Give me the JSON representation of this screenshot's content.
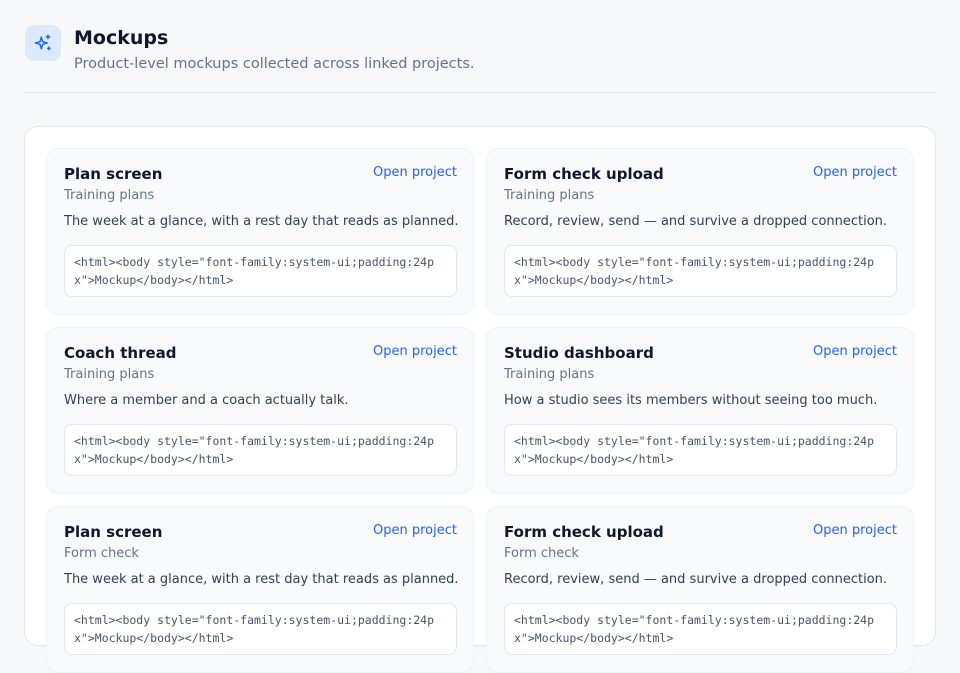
{
  "header": {
    "title": "Mockups",
    "subtitle": "Product-level mockups collected across linked projects.",
    "icon": "sparkles-icon",
    "accent": "#2563eb"
  },
  "cards": [
    {
      "title": "Plan screen",
      "link": "Open project",
      "project": "Training plans",
      "description": "The week at a glance, with a rest day that reads as planned.",
      "code": "<html><body style=\"font-family:system-ui;padding:24px\">Mockup</body></html>"
    },
    {
      "title": "Form check upload",
      "link": "Open project",
      "project": "Training plans",
      "description": "Record, review, send — and survive a dropped connection.",
      "code": "<html><body style=\"font-family:system-ui;padding:24px\">Mockup</body></html>"
    },
    {
      "title": "Coach thread",
      "link": "Open project",
      "project": "Training plans",
      "description": "Where a member and a coach actually talk.",
      "code": "<html><body style=\"font-family:system-ui;padding:24px\">Mockup</body></html>"
    },
    {
      "title": "Studio dashboard",
      "link": "Open project",
      "project": "Training plans",
      "description": "How a studio sees its members without seeing too much.",
      "code": "<html><body style=\"font-family:system-ui;padding:24px\">Mockup</body></html>"
    },
    {
      "title": "Plan screen",
      "link": "Open project",
      "project": "Form check",
      "description": "The week at a glance, with a rest day that reads as planned.",
      "code": "<html><body style=\"font-family:system-ui;padding:24px\">Mockup</body></html>"
    },
    {
      "title": "Form check upload",
      "link": "Open project",
      "project": "Form check",
      "description": "Record, review, send — and survive a dropped connection.",
      "code": "<html><body style=\"font-family:system-ui;padding:24px\">Mockup</body></html>"
    }
  ]
}
